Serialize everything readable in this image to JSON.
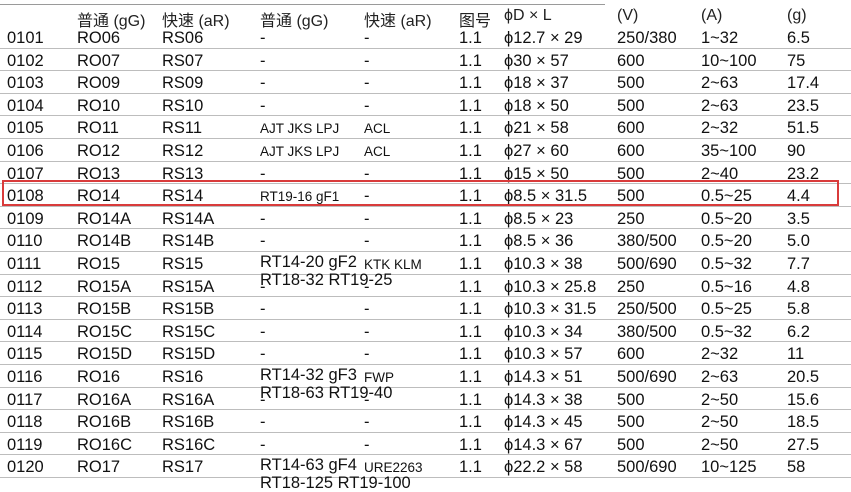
{
  "header": {
    "cols": [
      "普通 (gG)",
      "快速 (aR)",
      "普通 (gG)",
      "快速 (aR)",
      "图号",
      "ϕD × L",
      "(V)",
      "(A)",
      "(g)"
    ]
  },
  "rows": [
    {
      "code": "0101",
      "gG": "RO06",
      "aR": "RS06",
      "eq_gG": "-",
      "eq_aR": "-",
      "fig": "1.1",
      "dim": "ϕ12.7 × 29",
      "v": "250/380",
      "a": "1~32",
      "g": "6.5"
    },
    {
      "code": "0102",
      "gG": "RO07",
      "aR": "RS07",
      "eq_gG": "-",
      "eq_aR": "-",
      "fig": "1.1",
      "dim": "ϕ30 × 57",
      "v": "600",
      "a": "10~100",
      "g": "75"
    },
    {
      "code": "0103",
      "gG": "RO09",
      "aR": "RS09",
      "eq_gG": "-",
      "eq_aR": "-",
      "fig": "1.1",
      "dim": "ϕ18 × 37",
      "v": "500",
      "a": "2~63",
      "g": "17.4"
    },
    {
      "code": "0104",
      "gG": "RO10",
      "aR": "RS10",
      "eq_gG": "-",
      "eq_aR": "-",
      "fig": "1.1",
      "dim": "ϕ18 × 50",
      "v": "500",
      "a": "2~63",
      "g": "23.5"
    },
    {
      "code": "0105",
      "gG": "RO11",
      "aR": "RS11",
      "eq_gG": "AJT JKS LPJ",
      "eq_aR": "ACL",
      "fig": "1.1",
      "dim": "ϕ21 × 58",
      "v": "600",
      "a": "2~32",
      "g": "51.5"
    },
    {
      "code": "0106",
      "gG": "RO12",
      "aR": "RS12",
      "eq_gG": "AJT JKS LPJ",
      "eq_aR": "ACL",
      "fig": "1.1",
      "dim": "ϕ27 × 60",
      "v": "600",
      "a": "35~100",
      "g": "90"
    },
    {
      "code": "0107",
      "gG": "RO13",
      "aR": "RS13",
      "eq_gG": "-",
      "eq_aR": "-",
      "fig": "1.1",
      "dim": "ϕ15 × 50",
      "v": "500",
      "a": "2~40",
      "g": "23.2"
    },
    {
      "code": "0108",
      "gG": "RO14",
      "aR": "RS14",
      "eq_gG": "RT19-16 gF1",
      "eq_aR": "-",
      "fig": "1.1",
      "dim": "ϕ8.5 × 31.5",
      "v": "500",
      "a": "0.5~25",
      "g": "4.4"
    },
    {
      "code": "0109",
      "gG": "RO14A",
      "aR": "RS14A",
      "eq_gG": "-",
      "eq_aR": "-",
      "fig": "1.1",
      "dim": "ϕ8.5 × 23",
      "v": "250",
      "a": "0.5~20",
      "g": "3.5"
    },
    {
      "code": "0110",
      "gG": "RO14B",
      "aR": "RS14B",
      "eq_gG": "-",
      "eq_aR": "-",
      "fig": "1.1",
      "dim": "ϕ8.5 × 36",
      "v": "380/500",
      "a": "0.5~20",
      "g": "5.0"
    },
    {
      "code": "0111",
      "gG": "RO15",
      "aR": "RS15",
      "eq_gG_l1": "RT14-20 gF2",
      "eq_gG_l2": "RT18-32 RT19-25",
      "eq_aR": "KTK KLM",
      "fig": "1.1",
      "dim": "ϕ10.3 × 38",
      "v": "500/690",
      "a": "0.5~32",
      "g": "7.7"
    },
    {
      "code": "0112",
      "gG": "RO15A",
      "aR": "RS15A",
      "eq_gG": "-",
      "eq_aR": "-",
      "fig": "1.1",
      "dim": "ϕ10.3 × 25.8",
      "v": "250",
      "a": "0.5~16",
      "g": "4.8"
    },
    {
      "code": "0113",
      "gG": "RO15B",
      "aR": "RS15B",
      "eq_gG": "-",
      "eq_aR": "-",
      "fig": "1.1",
      "dim": "ϕ10.3 × 31.5",
      "v": "250/500",
      "a": "0.5~25",
      "g": "5.8"
    },
    {
      "code": "0114",
      "gG": "RO15C",
      "aR": "RS15C",
      "eq_gG": "-",
      "eq_aR": "-",
      "fig": "1.1",
      "dim": "ϕ10.3 × 34",
      "v": "380/500",
      "a": "0.5~32",
      "g": "6.2"
    },
    {
      "code": "0115",
      "gG": "RO15D",
      "aR": "RS15D",
      "eq_gG": "-",
      "eq_aR": "-",
      "fig": "1.1",
      "dim": "ϕ10.3 × 57",
      "v": "600",
      "a": "2~32",
      "g": "11"
    },
    {
      "code": "0116",
      "gG": "RO16",
      "aR": "RS16",
      "eq_gG_l1": "RT14-32 gF3",
      "eq_gG_l2": "RT18-63 RT19-40",
      "eq_aR": "FWP",
      "fig": "1.1",
      "dim": "ϕ14.3 × 51",
      "v": "500/690",
      "a": "2~63",
      "g": "20.5"
    },
    {
      "code": "0117",
      "gG": "RO16A",
      "aR": "RS16A",
      "eq_gG": "-",
      "eq_aR": "-",
      "fig": "1.1",
      "dim": "ϕ14.3 × 38",
      "v": "500",
      "a": "2~50",
      "g": "15.6"
    },
    {
      "code": "0118",
      "gG": "RO16B",
      "aR": "RS16B",
      "eq_gG": "-",
      "eq_aR": "-",
      "fig": "1.1",
      "dim": "ϕ14.3 × 45",
      "v": "500",
      "a": "2~50",
      "g": "18.5"
    },
    {
      "code": "0119",
      "gG": "RO16C",
      "aR": "RS16C",
      "eq_gG": "-",
      "eq_aR": "-",
      "fig": "1.1",
      "dim": "ϕ14.3 × 67",
      "v": "500",
      "a": "2~50",
      "g": "27.5"
    },
    {
      "code": "0120",
      "gG": "RO17",
      "aR": "RS17",
      "eq_gG_l1": "RT14-63 gF4",
      "eq_gG_l2": "RT18-125 RT19-100",
      "eq_aR": "URE2263",
      "fig": "1.1",
      "dim": "ϕ22.2 × 58",
      "v": "500/690",
      "a": "10~125",
      "g": "58"
    }
  ],
  "highlight": {
    "row": "0108",
    "color": "#d93b3b"
  }
}
